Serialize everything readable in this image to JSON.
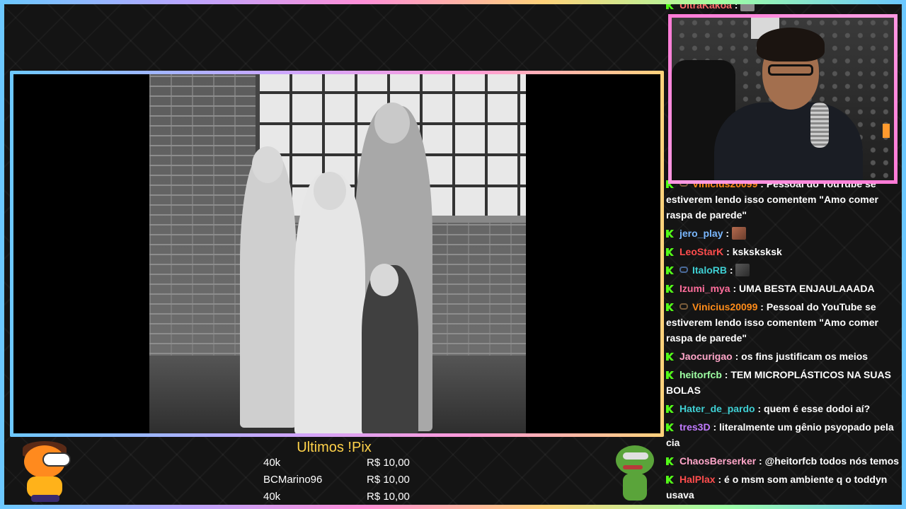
{
  "colors": {
    "accent_pink": "#ff7ad6",
    "pix_title": "#ffd24a",
    "kick_green": "#53fc18"
  },
  "overlay": {
    "pix_title": "Ultimos !Pix",
    "pix_rows": [
      {
        "name": "40k",
        "amount": "R$ 10,00"
      },
      {
        "name": "BCMarino96",
        "amount": "R$ 10,00"
      },
      {
        "name": "40k",
        "amount": "R$ 10,00"
      }
    ]
  },
  "chat": {
    "messages": [
      {
        "user": "UltraKakoa",
        "color": "#ff6b6b",
        "text": "",
        "emote": "em-c"
      },
      {
        "user": "Vinicius20099",
        "color": "#ff8c1a",
        "text": "Pessoal do YouTube se estiverem lendo isso comentem \"Amo comer raspa de parede\"",
        "emote": ""
      },
      {
        "user": "jero_play",
        "color": "#7ab8ff",
        "text": "",
        "emote": "em-a"
      },
      {
        "user": "LeoStarK",
        "color": "#ff4d4d",
        "text": "ksksksksk",
        "emote": ""
      },
      {
        "user": "ItaloRB",
        "color": "#3fd0d4",
        "text": "",
        "emote": "em-b"
      },
      {
        "user": "Izumi_mya",
        "color": "#ff6e9c",
        "text": "UMA BESTA ENJAULAAADA",
        "emote": ""
      },
      {
        "user": "Vinicius20099",
        "color": "#ff8c1a",
        "text": "Pessoal do YouTube se estiverem lendo isso comentem \"Amo comer raspa de parede\"",
        "emote": ""
      },
      {
        "user": "Jaocurigao",
        "color": "#ffa6c9",
        "text": "os fins justificam os meios",
        "emote": ""
      },
      {
        "user": "heitorfcb",
        "color": "#9effa3",
        "text": "TEM MICROPLÁSTICOS NA SUAS BOLAS",
        "emote": ""
      },
      {
        "user": "Hater_de_pardo",
        "color": "#3fd0d4",
        "text": "quem é esse dodoi aí?",
        "emote": ""
      },
      {
        "user": "tres3D",
        "color": "#c17bff",
        "text": "literalmente um gênio psyopado pela cia",
        "emote": ""
      },
      {
        "user": "ChaosBerserker",
        "color": "#ffa6c9",
        "text": "@heitorfcb todos nós temos",
        "emote": ""
      },
      {
        "user": "HalPlax",
        "color": "#ff4d4d",
        "text": "é o msm som ambiente q o toddyn usava",
        "emote": ""
      }
    ]
  }
}
